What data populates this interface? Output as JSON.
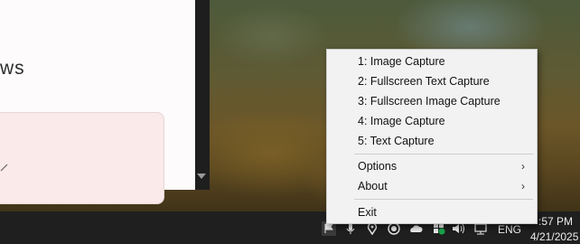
{
  "context_menu": {
    "items": [
      {
        "label": "1: Image Capture"
      },
      {
        "label": "2: Fullscreen Text Capture"
      },
      {
        "label": "3: Fullscreen Image Capture"
      },
      {
        "label": "4: Image Capture"
      },
      {
        "label": "5: Text Capture"
      }
    ],
    "options_label": "Options",
    "about_label": "About",
    "exit_label": "Exit",
    "submenu_chevron": "›"
  },
  "app_window": {
    "heading_fragment": "ws"
  },
  "taskbar": {
    "language": "ENG",
    "time": ":57 PM",
    "date": "4/21/2025",
    "tray_icons": [
      "flag-icon",
      "microphone-icon",
      "location-icon",
      "recording-icon",
      "onedrive-cloud-icon",
      "security-shield-icon",
      "volume-icon",
      "network-icon"
    ]
  },
  "colors": {
    "menu_background": "#f2f2f2",
    "taskbar_background": "#1f1f1f",
    "app_card_background": "#fbeaea"
  }
}
